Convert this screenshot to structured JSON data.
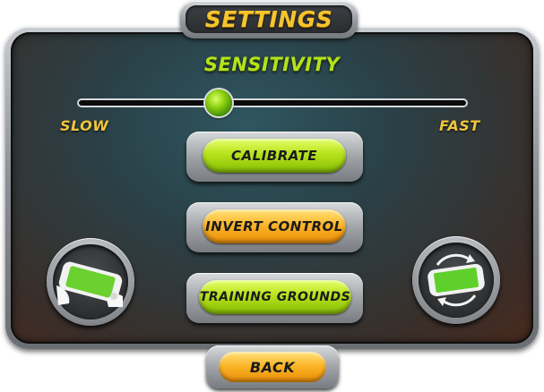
{
  "title": "SETTINGS",
  "sensitivity": {
    "label": "SENSITIVITY",
    "min_label": "SLOW",
    "max_label": "FAST",
    "value": 0.36
  },
  "buttons": {
    "calibrate": "CALIBRATE",
    "invert_control": "INVERT CONTROL",
    "training_grounds": "TRAINING GROUNDS",
    "back": "BACK"
  },
  "icons": {
    "left_round": "tilt-device-icon",
    "right_round": "rotate-device-icon"
  },
  "colors": {
    "title_yellow": "#f5c42e",
    "label_green": "#b4e21c",
    "pill_green": "#b6e21a",
    "pill_orange": "#fbb224"
  }
}
